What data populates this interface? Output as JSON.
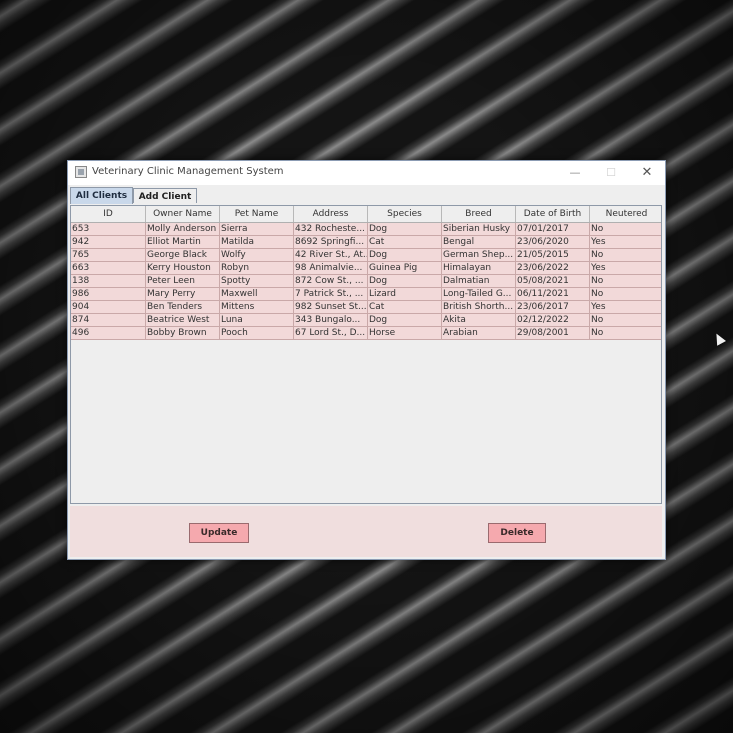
{
  "window": {
    "title": "Veterinary Clinic Management System",
    "minimize_glyph": "—",
    "maximize_glyph": "☐",
    "close_glyph": "✕"
  },
  "tabs": [
    {
      "label": "All Clients",
      "selected": true
    },
    {
      "label": "Add Client",
      "selected": false
    }
  ],
  "table": {
    "columns": [
      "ID",
      "Owner Name",
      "Pet Name",
      "Address",
      "Species",
      "Breed",
      "Date of Birth",
      "Neutered"
    ],
    "rows": [
      [
        "653",
        "Molly Anderson",
        "Sierra",
        "432 Rocheste...",
        "Dog",
        "Siberian Husky",
        "07/01/2017",
        "No"
      ],
      [
        "942",
        "Elliot Martin",
        "Matilda",
        "8692 Springfi...",
        "Cat",
        "Bengal",
        "23/06/2020",
        "Yes"
      ],
      [
        "765",
        "George Black",
        "Wolfy",
        "42 River St., At...",
        "Dog",
        "German Shep...",
        "21/05/2015",
        "No"
      ],
      [
        "663",
        "Kerry Houston",
        "Robyn",
        "98 Animalvie...",
        "Guinea Pig",
        "Himalayan",
        "23/06/2022",
        "Yes"
      ],
      [
        "138",
        "Peter Leen",
        "Spotty",
        "872 Cow St., ...",
        "Dog",
        "Dalmatian",
        "05/08/2021",
        "No"
      ],
      [
        "986",
        "Mary Perry",
        "Maxwell",
        "7 Patrick St., ...",
        "Lizard",
        "Long-Tailed G...",
        "06/11/2021",
        "No"
      ],
      [
        "904",
        "Ben Tenders",
        "Mittens",
        "982 Sunset St...",
        "Cat",
        "British Shorth...",
        "23/06/2017",
        "Yes"
      ],
      [
        "874",
        "Beatrice West",
        "Luna",
        "343 Bungalo...",
        "Dog",
        "Akita",
        "02/12/2022",
        "No"
      ],
      [
        "496",
        "Bobby Brown",
        "Pooch",
        "67 Lord St., D...",
        "Horse",
        "Arabian",
        "29/08/2001",
        "No"
      ]
    ]
  },
  "buttons": {
    "update_label": "Update",
    "delete_label": "Delete"
  },
  "colors": {
    "row_bg": "#f2d9d9",
    "button_bg": "#f5a9ae",
    "selected_tab": "#c9d8ea"
  }
}
